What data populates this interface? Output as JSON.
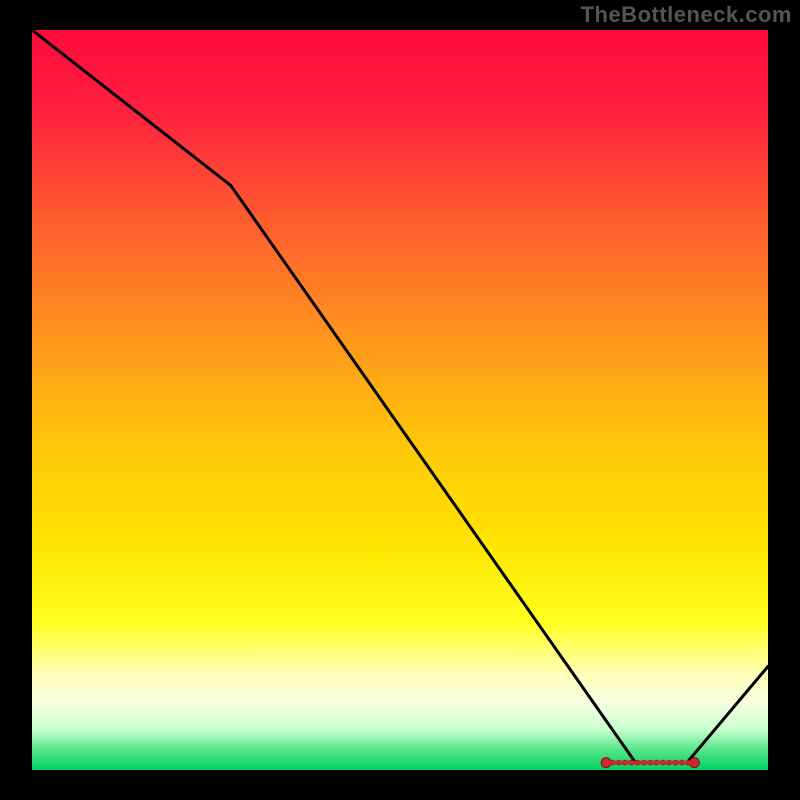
{
  "watermark": "TheBottleneck.com",
  "chart_data": {
    "type": "line",
    "title": "",
    "xlabel": "",
    "ylabel": "",
    "xlim": [
      0,
      100
    ],
    "ylim": [
      0,
      100
    ],
    "x": [
      0,
      27,
      82,
      89,
      100
    ],
    "y": [
      100,
      79,
      1,
      1,
      14
    ],
    "flat_segment": {
      "x0": 78,
      "x1": 90,
      "y": 1
    },
    "gradient_stops": [
      {
        "offset": 0.0,
        "color": "#ff0a3a"
      },
      {
        "offset": 0.1,
        "color": "#ff1d3f"
      },
      {
        "offset": 0.25,
        "color": "#ff5a30"
      },
      {
        "offset": 0.4,
        "color": "#ff8f1f"
      },
      {
        "offset": 0.55,
        "color": "#ffc40a"
      },
      {
        "offset": 0.7,
        "color": "#ffe600"
      },
      {
        "offset": 0.8,
        "color": "#ffff20"
      },
      {
        "offset": 0.87,
        "color": "#ffffb8"
      },
      {
        "offset": 0.91,
        "color": "#f4ffe0"
      },
      {
        "offset": 0.945,
        "color": "#c8ffd0"
      },
      {
        "offset": 0.97,
        "color": "#60e890"
      },
      {
        "offset": 1.0,
        "color": "#00d060"
      }
    ],
    "marker_color": "#cc2b2b",
    "marker_stroke": "#7a1414",
    "line_color": "#000000",
    "line_width": 3
  }
}
